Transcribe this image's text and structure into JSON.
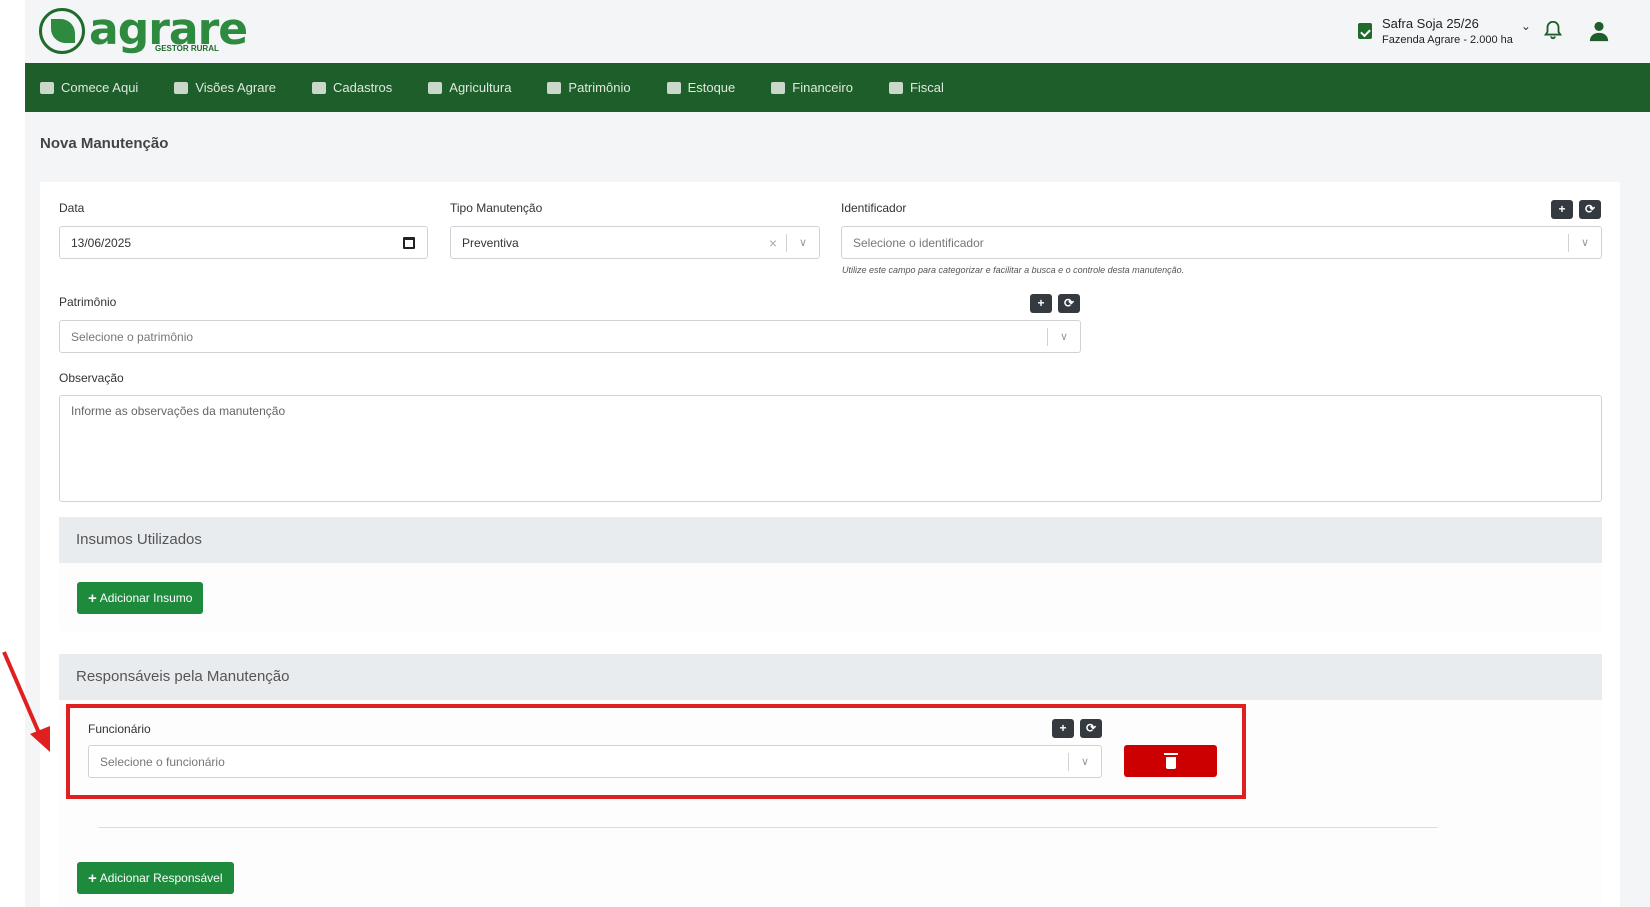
{
  "header": {
    "logo_text": "agrare",
    "logo_sub": "GESTOR RURAL",
    "season_title": "Safra Soja 25/26",
    "season_sub": "Fazenda Agrare - 2.000 ha"
  },
  "nav": {
    "items": [
      {
        "label": "Comece Aqui"
      },
      {
        "label": "Visões Agrare"
      },
      {
        "label": "Cadastros"
      },
      {
        "label": "Agricultura"
      },
      {
        "label": "Patrimônio"
      },
      {
        "label": "Estoque"
      },
      {
        "label": "Financeiro"
      },
      {
        "label": "Fiscal"
      }
    ]
  },
  "page": {
    "title": "Nova Manutenção"
  },
  "form": {
    "data_label": "Data",
    "data_value": "13/06/2025",
    "tipo_label": "Tipo Manutenção",
    "tipo_value": "Preventiva",
    "identificador_label": "Identificador",
    "identificador_placeholder": "Selecione o identificador",
    "identificador_hint": "Utilize este campo para categorizar e facilitar a busca e o controle desta manutenção.",
    "patrimonio_label": "Patrimônio",
    "patrimonio_placeholder": "Selecione o patrimônio",
    "observacao_label": "Observação",
    "observacao_placeholder": "Informe as observações da manutenção",
    "add_symbol": "+",
    "refresh_symbol": "⟳"
  },
  "insumos": {
    "title": "Insumos Utilizados",
    "add_button": "Adicionar Insumo"
  },
  "responsaveis": {
    "title": "Responsáveis pela Manutenção",
    "funcionario_label": "Funcionário",
    "funcionario_placeholder": "Selecione o funcionário",
    "add_button": "Adicionar Responsável"
  },
  "colors": {
    "brand_green": "#1e5e2a",
    "button_green": "#1e8a3c",
    "delete_red": "#cc0000",
    "highlight_red": "#e02020"
  }
}
